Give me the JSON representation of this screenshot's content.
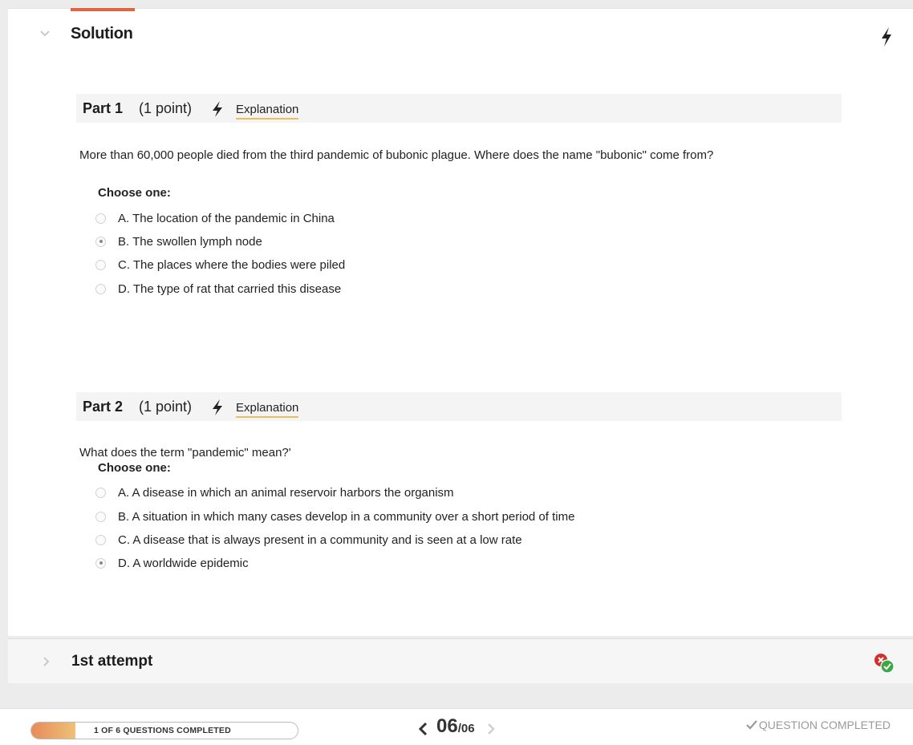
{
  "solution": {
    "title": "Solution",
    "parts": [
      {
        "label": "Part 1",
        "points": "(1 point)",
        "explanation": "Explanation",
        "question": "More than 60,000 people died from the third pandemic of bubonic plague. Where does the name \"bubonic\" come from?",
        "choose_label": "Choose one:",
        "options": [
          {
            "text": "A. The location of the pandemic in China",
            "selected": false
          },
          {
            "text": "B. The swollen lymph node",
            "selected": true
          },
          {
            "text": "C. The places where the bodies were piled",
            "selected": false
          },
          {
            "text": "D. The type of rat that carried this disease",
            "selected": false
          }
        ]
      },
      {
        "label": "Part 2",
        "points": "(1 point)",
        "explanation": "Explanation",
        "question": "What does the term \"pandemic\" mean?'",
        "choose_label": "Choose one:",
        "options": [
          {
            "text": "A. A disease in which an animal reservoir harbors the organism",
            "selected": false
          },
          {
            "text": "B. A situation in which many cases develop in a community over a short period of time",
            "selected": false
          },
          {
            "text": "C. A disease that is always present in a community and is seen at a low rate",
            "selected": false
          },
          {
            "text": "D. A worldwide epidemic",
            "selected": true
          }
        ]
      }
    ]
  },
  "attempt": {
    "title": "1st attempt",
    "status_icon": "incorrect-then-correct-icon"
  },
  "footer": {
    "progress_text": "1 OF 6 QUESTIONS COMPLETED",
    "progress_fraction": 0.1667,
    "pager_current": "06",
    "pager_total": "/06",
    "completed_text": "QUESTION COMPLETED"
  },
  "colors": {
    "accent": "#e2633f",
    "explanation_underline": "#e8c05a",
    "progress_start": "#e88a5a",
    "progress_end": "#eec178",
    "incorrect": "#d0312d",
    "correct": "#3aa845"
  }
}
